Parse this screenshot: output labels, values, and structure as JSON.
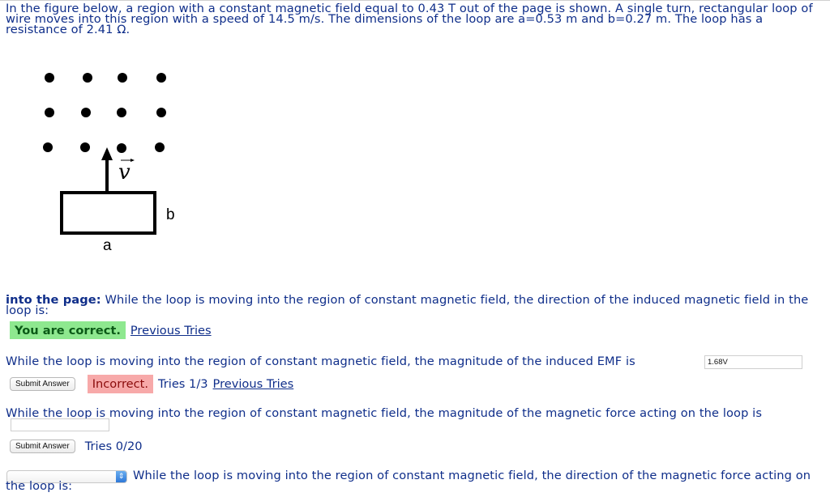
{
  "problem": {
    "intro": "In the figure below, a region with a constant magnetic field equal to 0.43 T out of the page is shown. A single turn, rectangular loop of wire moves into this region with a speed of 14.5 m/s. The dimensions of the loop are a=0.53 m and b=0.27 m. The loop has a resistance of 2.41 Ω.",
    "figure": {
      "velocity_label": "v",
      "width_label": "a",
      "height_label": "b",
      "field_symbol": "dots (out of page)"
    }
  },
  "questions": [
    {
      "prefix": "into the page:",
      "text": "While the loop is moving into the region of constant magnetic field, the direction of the induced magnetic field in the loop is:",
      "status": "You are correct.",
      "previous_tries_link": "Previous Tries",
      "status_color": "#8ee88f"
    },
    {
      "text": "While the loop is moving into the region of constant magnetic field, the magnitude of the induced EMF is",
      "answer_value": "1.68V",
      "submit_label": "Submit Answer",
      "status": "Incorrect.",
      "tries": "Tries 1/3",
      "previous_tries_link": "Previous Tries",
      "status_color": "#f7a9a9"
    },
    {
      "text": "While the loop is moving into the region of constant magnetic field, the magnitude of the magnetic force acting on the loop is",
      "answer_value": "",
      "submit_label": "Submit Answer",
      "tries": "Tries 0/20"
    },
    {
      "text": "While the loop is moving into the region of constant magnetic field, the direction of the magnetic force acting on the loop is:",
      "selected_option": ""
    }
  ]
}
